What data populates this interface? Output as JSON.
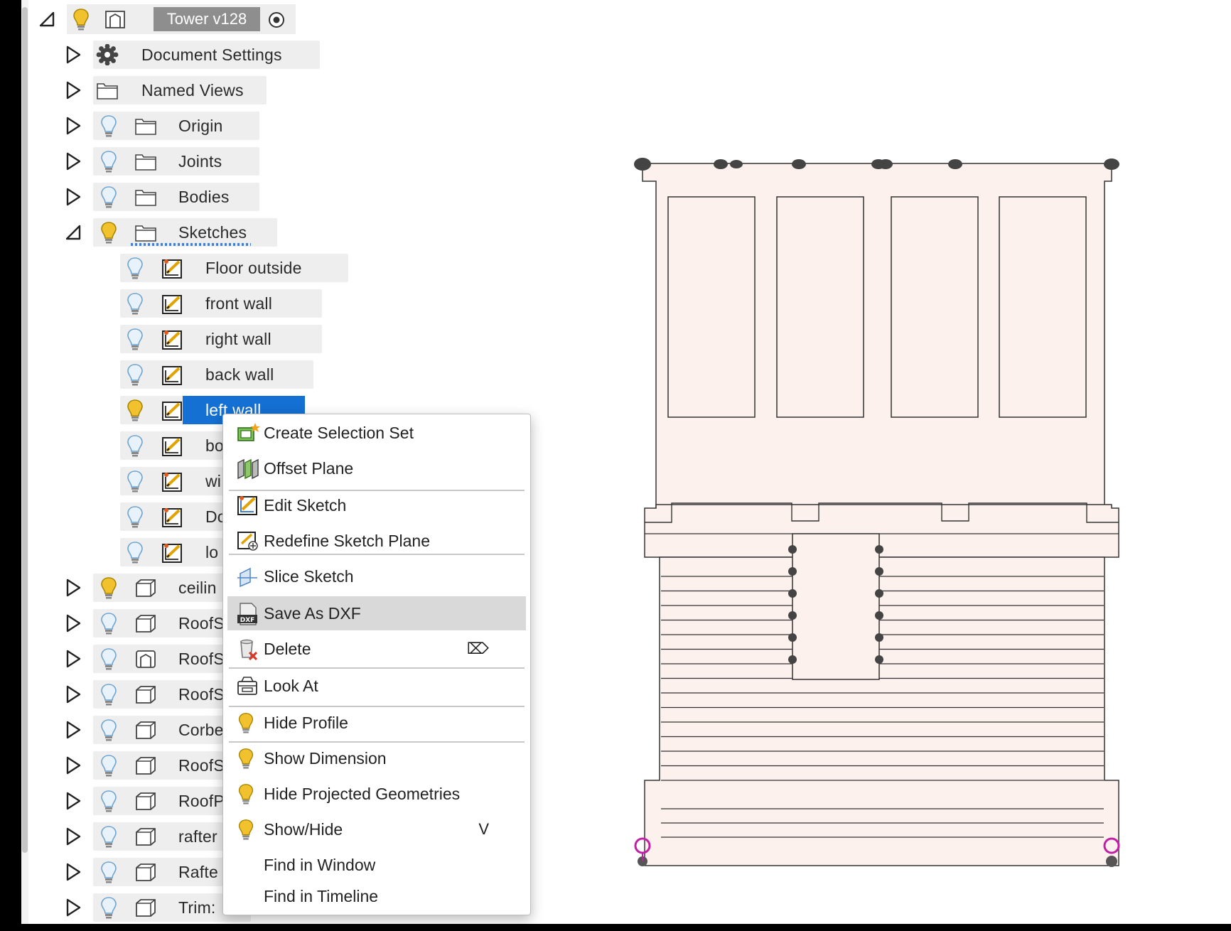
{
  "root": {
    "label": "Tower v128"
  },
  "tree": [
    {
      "label": "Document Settings",
      "icon": "gear-icon",
      "expanded": false
    },
    {
      "label": "Named Views",
      "icon": "folder-icon",
      "expanded": false
    },
    {
      "label": "Origin",
      "icon": "folder-icon",
      "expanded": false
    },
    {
      "label": "Joints",
      "icon": "folder-icon",
      "expanded": false
    },
    {
      "label": "Bodies",
      "icon": "folder-icon",
      "expanded": false
    },
    {
      "label": "Sketches",
      "icon": "folder-icon",
      "expanded": true
    },
    {
      "label": "Floor outside",
      "icon": "sketch-icon"
    },
    {
      "label": "front wall",
      "icon": "sketch-icon"
    },
    {
      "label": "right wall",
      "icon": "sketch-icon"
    },
    {
      "label": "back wall",
      "icon": "sketch-icon"
    },
    {
      "label": "left wall",
      "icon": "sketch-icon",
      "selected": true
    },
    {
      "label": "bo",
      "icon": "sketch-icon"
    },
    {
      "label": "wi",
      "icon": "sketch-icon"
    },
    {
      "label": "Do",
      "icon": "sketch-icon"
    },
    {
      "label": "lo",
      "icon": "sketch-icon"
    },
    {
      "label": "ceilin",
      "icon": "component-icon"
    },
    {
      "label": "RoofS",
      "icon": "component-icon"
    },
    {
      "label": "RoofS",
      "icon": "component-icon"
    },
    {
      "label": "RoofS",
      "icon": "component-icon"
    },
    {
      "label": "Corbe",
      "icon": "component-icon"
    },
    {
      "label": "RoofS",
      "icon": "component-icon"
    },
    {
      "label": "RoofP",
      "icon": "component-icon"
    },
    {
      "label": "rafter",
      "icon": "component-icon"
    },
    {
      "label": "Rafte",
      "icon": "component-icon"
    },
    {
      "label": "Trim:",
      "icon": "component-icon"
    }
  ],
  "context_menu": {
    "items": [
      {
        "label": "Create Selection Set",
        "icon": "selection-set-icon"
      },
      {
        "label": "Offset Plane",
        "icon": "offset-plane-icon"
      },
      {
        "label": "Edit Sketch",
        "icon": "edit-sketch-icon"
      },
      {
        "label": "Redefine Sketch Plane",
        "icon": "redefine-sketch-plane-icon"
      },
      {
        "label": "Slice Sketch",
        "icon": "slice-sketch-icon"
      },
      {
        "label": "Save As DXF",
        "icon": "dxf-file-icon",
        "highlighted": true
      },
      {
        "label": "Delete",
        "icon": "delete-icon",
        "shortcut": "⌦"
      },
      {
        "label": "Look At",
        "icon": "look-at-icon"
      },
      {
        "label": "Hide Profile",
        "icon": "lightbulb-icon"
      },
      {
        "label": "Show Dimension",
        "icon": "lightbulb-icon"
      },
      {
        "label": "Hide Projected Geometries",
        "icon": "lightbulb-icon"
      },
      {
        "label": "Show/Hide",
        "icon": "lightbulb-icon",
        "shortcut": "V"
      },
      {
        "label": "Find in Window",
        "icon": ""
      },
      {
        "label": "Find in Timeline",
        "icon": ""
      }
    ],
    "dxf_badge": "DXF"
  },
  "colors": {
    "selection": "#1470d2",
    "sketch_fill": "#fdf1ee",
    "bulb_on": "#f2c12e",
    "bulb_off": "#a9cde8",
    "constraint_point": "#c21fa6"
  }
}
